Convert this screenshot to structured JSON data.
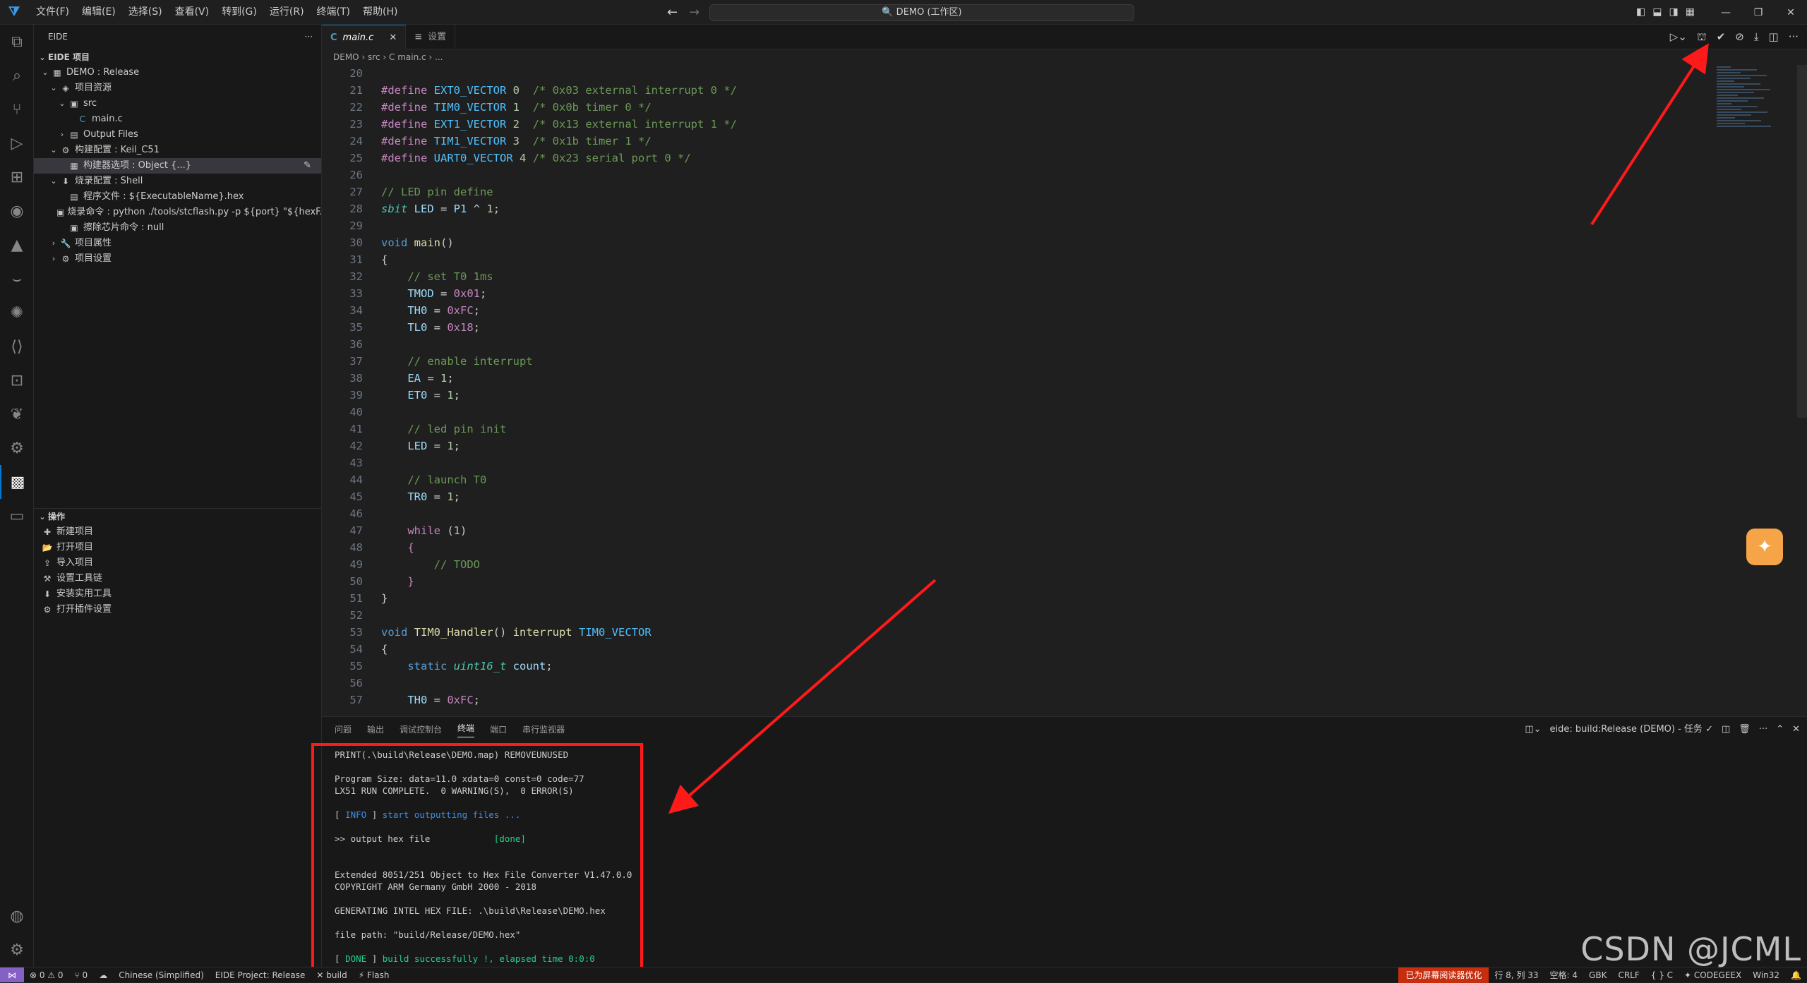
{
  "titlebar": {
    "menu": [
      "文件(F)",
      "编辑(E)",
      "选择(S)",
      "查看(V)",
      "转到(G)",
      "运行(R)",
      "终端(T)",
      "帮助(H)"
    ],
    "command_center": "🔍 DEMO (工作区)"
  },
  "sidebar": {
    "title": "EIDE",
    "more": "···",
    "section_project": "EIDE 项目",
    "tree": [
      {
        "indent": 0,
        "twistie": "⌄",
        "icon": "▦",
        "label": "DEMO : Release"
      },
      {
        "indent": 1,
        "twistie": "⌄",
        "icon": "◈",
        "label": "项目资源"
      },
      {
        "indent": 2,
        "twistie": "⌄",
        "icon": "▣",
        "label": "src"
      },
      {
        "indent": 3,
        "twistie": "",
        "icon": "C",
        "label": "main.c"
      },
      {
        "indent": 2,
        "twistie": "›",
        "icon": "▤",
        "label": "Output Files"
      },
      {
        "indent": 1,
        "twistie": "⌄",
        "icon": "⚙",
        "label": "构建配置 : Keil_C51"
      },
      {
        "indent": 2,
        "twistie": "",
        "icon": "▦",
        "label": "构建器选项 : Object {...}",
        "selected": true
      },
      {
        "indent": 1,
        "twistie": "⌄",
        "icon": "⬇",
        "label": "烧录配置 : Shell"
      },
      {
        "indent": 2,
        "twistie": "",
        "icon": "▤",
        "label": "程序文件 : ${ExecutableName}.hex"
      },
      {
        "indent": 2,
        "twistie": "",
        "icon": "▣",
        "label": "烧录命令 : python ./tools/stcflash.py -p ${port} \"${hexF..."
      },
      {
        "indent": 2,
        "twistie": "",
        "icon": "▣",
        "label": "擦除芯片命令 : null"
      },
      {
        "indent": 1,
        "twistie": "›",
        "icon": "🔧",
        "label": "项目属性"
      },
      {
        "indent": 1,
        "twistie": "›",
        "icon": "⚙",
        "label": "项目设置"
      }
    ],
    "section_ops": "操作",
    "ops": [
      {
        "icon": "✚",
        "label": "新建项目"
      },
      {
        "icon": "📂",
        "label": "打开项目"
      },
      {
        "icon": "⇪",
        "label": "导入项目"
      },
      {
        "icon": "⚒",
        "label": "设置工具链"
      },
      {
        "icon": "⬇",
        "label": "安装实用工具"
      },
      {
        "icon": "⚙",
        "label": "打开插件设置"
      }
    ]
  },
  "tabs": [
    {
      "label": "main.c",
      "active": true,
      "icon": "C",
      "close": "✕"
    },
    {
      "label": "设置",
      "active": false,
      "icon": "≡",
      "close": ""
    }
  ],
  "breadcrumb": "DEMO  ›  src  ›  C  main.c  ›  ...",
  "code": [
    {
      "n": 20,
      "html": ""
    },
    {
      "n": 21,
      "html": "<span class='pp'>#define</span> <span class='mc'>EXT0_VECTOR</span> <span class='num'>0</span>  <span class='cm'>/* 0x03 external interrupt 0 */</span>"
    },
    {
      "n": 22,
      "html": "<span class='pp'>#define</span> <span class='mc'>TIM0_VECTOR</span> <span class='num'>1</span>  <span class='cm'>/* 0x0b timer 0 */</span>"
    },
    {
      "n": 23,
      "html": "<span class='pp'>#define</span> <span class='mc'>EXT1_VECTOR</span> <span class='num'>2</span>  <span class='cm'>/* 0x13 external interrupt 1 */</span>"
    },
    {
      "n": 24,
      "html": "<span class='pp'>#define</span> <span class='mc'>TIM1_VECTOR</span> <span class='num'>3</span>  <span class='cm'>/* 0x1b timer 1 */</span>"
    },
    {
      "n": 25,
      "html": "<span class='pp'>#define</span> <span class='mc'>UART0_VECTOR</span> <span class='num'>4</span> <span class='cm'>/* 0x23 serial port 0 */</span>"
    },
    {
      "n": 26,
      "html": ""
    },
    {
      "n": 27,
      "html": "<span class='cm'>// LED pin define</span>"
    },
    {
      "n": 28,
      "html": "<span class='ty'>sbit</span> <span class='vr'>LED</span> = <span class='vr'>P1</span> ^ <span class='num'>1</span>;"
    },
    {
      "n": 29,
      "html": ""
    },
    {
      "n": 30,
      "html": "<span class='kw' style='color:#569cd6'>void</span> <span class='fn'>main</span>()"
    },
    {
      "n": 31,
      "html": "{"
    },
    {
      "n": 32,
      "html": "    <span class='cm'>// set T0 1ms</span>"
    },
    {
      "n": 33,
      "html": "    <span class='vr'>TMOD</span> = <span class='kw'>0x01</span>;"
    },
    {
      "n": 34,
      "html": "    <span class='vr'>TH0</span> = <span class='kw'>0xFC</span>;"
    },
    {
      "n": 35,
      "html": "    <span class='vr'>TL0</span> = <span class='kw'>0x18</span>;"
    },
    {
      "n": 36,
      "html": ""
    },
    {
      "n": 37,
      "html": "    <span class='cm'>// enable interrupt</span>"
    },
    {
      "n": 38,
      "html": "    <span class='vr'>EA</span> = <span class='num'>1</span>;"
    },
    {
      "n": 39,
      "html": "    <span class='vr'>ET0</span> = <span class='num'>1</span>;"
    },
    {
      "n": 40,
      "html": ""
    },
    {
      "n": 41,
      "html": "    <span class='cm'>// led pin init</span>"
    },
    {
      "n": 42,
      "html": "    <span class='vr'>LED</span> = <span class='num'>1</span>;"
    },
    {
      "n": 43,
      "html": ""
    },
    {
      "n": 44,
      "html": "    <span class='cm'>// launch T0</span>"
    },
    {
      "n": 45,
      "html": "    <span class='vr'>TR0</span> = <span class='num'>1</span>;"
    },
    {
      "n": 46,
      "html": ""
    },
    {
      "n": 47,
      "html": "    <span class='kw'>while</span> (<span class='num'>1</span>)"
    },
    {
      "n": 48,
      "html": "    <span class='kw'>{</span>"
    },
    {
      "n": 49,
      "html": "        <span class='cm'>// TODO</span>"
    },
    {
      "n": 50,
      "html": "    <span class='kw'>}</span>"
    },
    {
      "n": 51,
      "html": "}"
    },
    {
      "n": 52,
      "html": ""
    },
    {
      "n": 53,
      "html": "<span class='kw' style='color:#569cd6'>void</span> <span class='fn'>TIM0_Handler</span>() <span class='fn'>interrupt</span> <span class='mc'>TIM0_VECTOR</span>"
    },
    {
      "n": 54,
      "html": "{"
    },
    {
      "n": 55,
      "html": "    <span class='kw' style='color:#569cd6'>static</span> <span class='ty'>uint16_t</span> <span class='vr'>count</span>;"
    },
    {
      "n": 56,
      "html": ""
    },
    {
      "n": 57,
      "html": "    <span class='vr'>TH0</span> = <span class='kw'>0xFC</span>;"
    }
  ],
  "panel": {
    "tabs": [
      "问题",
      "输出",
      "调试控制台",
      "终端",
      "端口",
      "串行监视器"
    ],
    "active_tab": "终端",
    "task_label": "eide: build:Release (DEMO) - 任务",
    "terminal": [
      {
        "cls": "",
        "text": "PRINT(.\\build\\Release\\DEMO.map) REMOVEUNUSED"
      },
      {
        "cls": "",
        "text": ""
      },
      {
        "cls": "",
        "text": "Program Size: data=11.0 xdata=0 const=0 code=77"
      },
      {
        "cls": "",
        "text": "LX51 RUN COMPLETE.  0 WARNING(S),  0 ERROR(S)"
      },
      {
        "cls": "",
        "text": ""
      },
      {
        "cls": "info",
        "text": "[ INFO ] start outputting files ..."
      },
      {
        "cls": "",
        "text": ""
      },
      {
        "cls": "done",
        "text": ">> output hex file            [done]"
      },
      {
        "cls": "",
        "text": ""
      },
      {
        "cls": "",
        "text": ""
      },
      {
        "cls": "",
        "text": "Extended 8051/251 Object to Hex File Converter V1.47.0.0"
      },
      {
        "cls": "",
        "text": "COPYRIGHT ARM Germany GmbH 2000 - 2018"
      },
      {
        "cls": "",
        "text": ""
      },
      {
        "cls": "",
        "text": "GENERATING INTEL HEX FILE: .\\build\\Release\\DEMO.hex"
      },
      {
        "cls": "",
        "text": ""
      },
      {
        "cls": "",
        "text": "file path: \"build/Release/DEMO.hex\""
      },
      {
        "cls": "",
        "text": ""
      },
      {
        "cls": "done2",
        "text": "[ DONE ] build successfully !, elapsed time 0:0:0"
      }
    ]
  },
  "statusbar": {
    "remote": "⋈",
    "problems": "⊗ 0 ⚠ 0",
    "ports": "⑂ 0",
    "lang_icon": "☁",
    "locale": "Chinese (Simplified)",
    "eide_project": "EIDE Project: Release",
    "build": "✕ build",
    "flash": "⚡ Flash",
    "screen_reader": "已为屏幕阅读器优化",
    "position": "行 8, 列 33",
    "spaces": "空格: 4",
    "encoding": "GBK",
    "eol": "CRLF",
    "language": "{ } C",
    "codegeex": "✦ CODEGEEX",
    "platform": "Win32",
    "bell": "🔔"
  },
  "watermark": "CSDN @JCML",
  "colors": {
    "annotation_red": "#ff1a1a",
    "accent_blue": "#0078d4",
    "remote_purple": "#8661c5",
    "screen_reader_red": "#c72e0f"
  }
}
